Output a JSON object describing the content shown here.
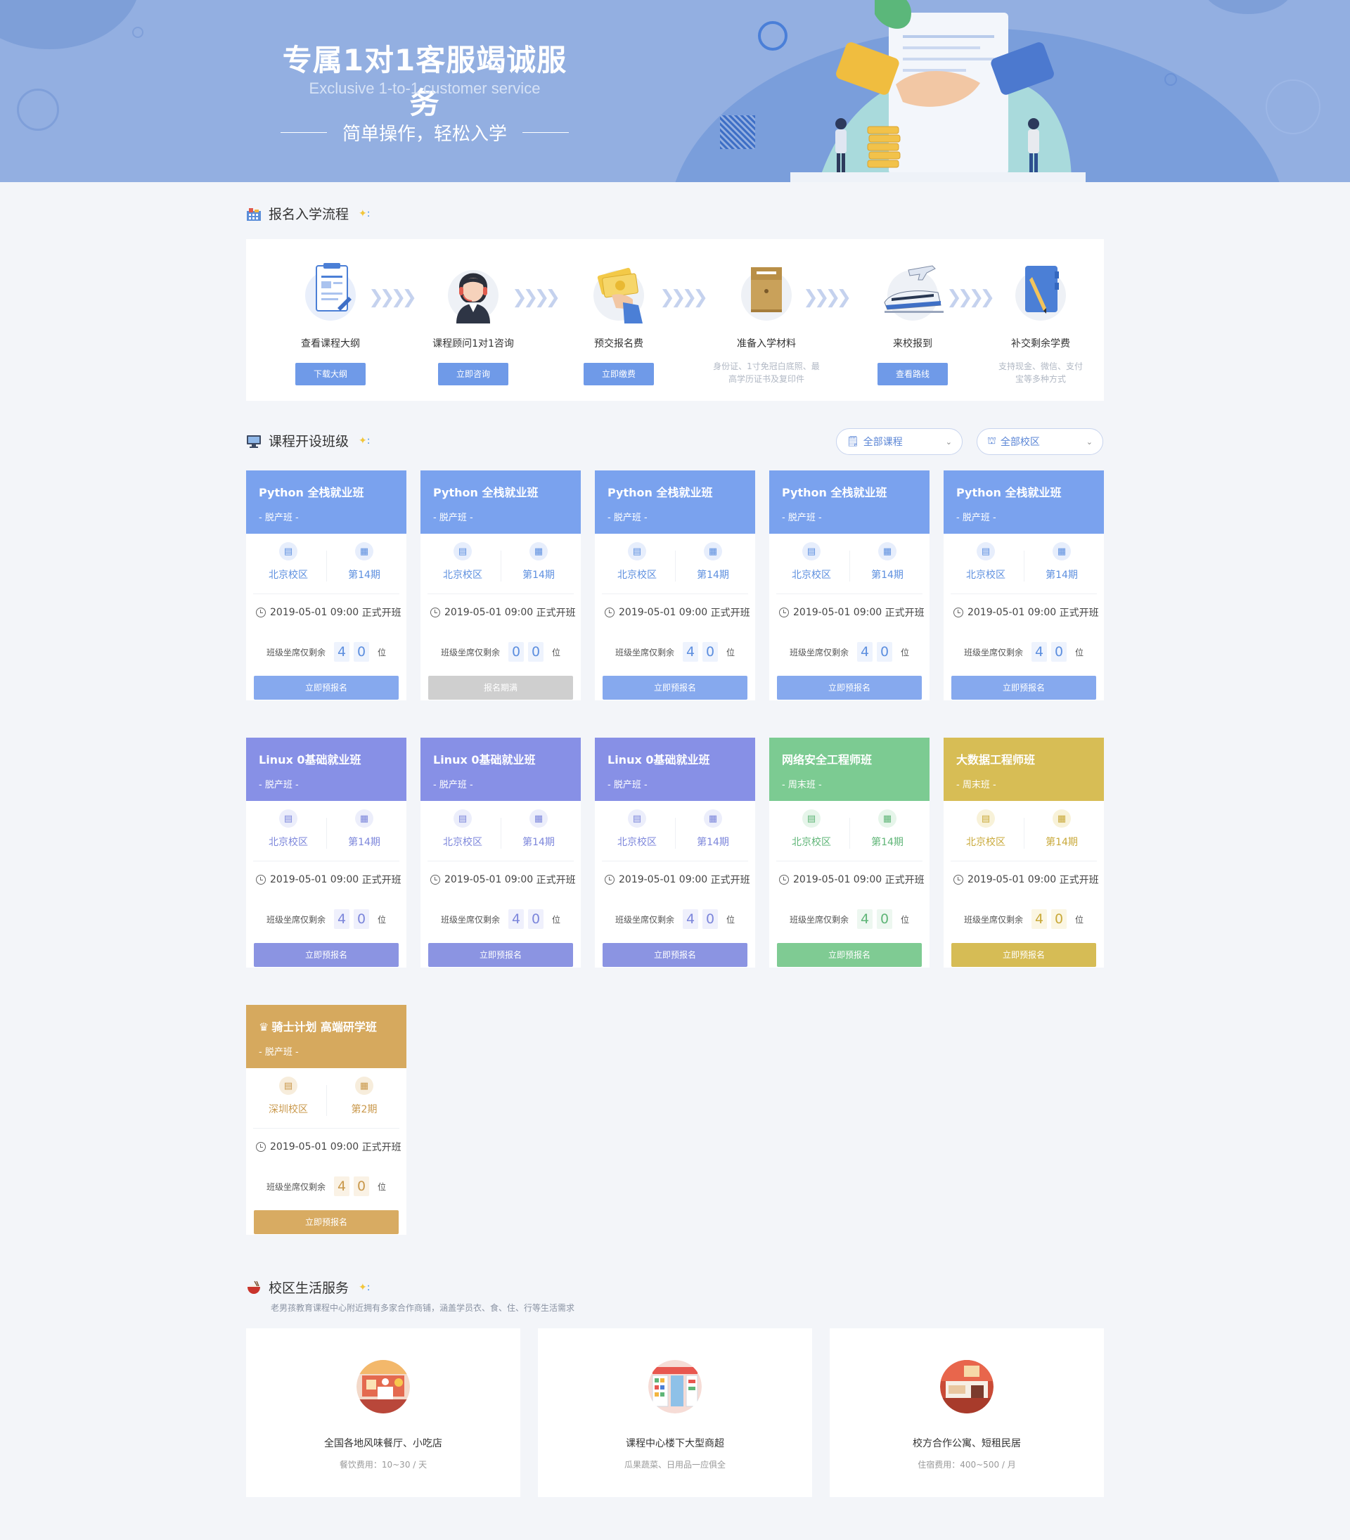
{
  "banner": {
    "title": "专属1对1客服竭诚服务",
    "subtitle": "Exclusive 1-to-1 customer service",
    "slogan": "简单操作，轻松入学"
  },
  "enroll": {
    "title": "报名入学流程",
    "steps": [
      {
        "name": "查看课程大纲",
        "button": "下载大纲",
        "icon": "syllabus-doc-icon"
      },
      {
        "name": "课程顾问1对1咨询",
        "button": "立即咨询",
        "icon": "consultant-headset-icon"
      },
      {
        "name": "预交报名费",
        "button": "立即缴费",
        "icon": "money-hand-icon"
      },
      {
        "name": "准备入学材料",
        "note": "身份证、1寸免冠白底照、最高学历证书及复印件",
        "icon": "folder-icon"
      },
      {
        "name": "来校报到",
        "button": "查看路线",
        "icon": "train-plane-icon"
      },
      {
        "name": "补交剩余学费",
        "note": "支持现金、微信、支付宝等多种方式",
        "icon": "notebook-pen-icon"
      }
    ]
  },
  "courses": {
    "title": "课程开设班级",
    "filters": [
      {
        "label": "全部课程",
        "icon": "course-list-icon"
      },
      {
        "label": "全部校区",
        "icon": "campus-icon"
      }
    ],
    "time_suffix": "正式开班",
    "seats_label": "班级坐席仅剩余",
    "seats_unit": "位",
    "cards": [
      {
        "title": "Python 全栈就业班",
        "sub": "- 脱产班 -",
        "campus": "北京校区",
        "period": "第14期",
        "date": "2019-05-01 09:00",
        "seats": [
          "4",
          "0"
        ],
        "button": "立即预报名",
        "theme": "blue"
      },
      {
        "title": "Python 全栈就业班",
        "sub": "- 脱产班 -",
        "campus": "北京校区",
        "period": "第14期",
        "date": "2019-05-01 09:00",
        "seats": [
          "0",
          "0"
        ],
        "button": "报名期满",
        "theme": "blue",
        "full": true
      },
      {
        "title": "Python 全栈就业班",
        "sub": "- 脱产班 -",
        "campus": "北京校区",
        "period": "第14期",
        "date": "2019-05-01 09:00",
        "seats": [
          "4",
          "0"
        ],
        "button": "立即预报名",
        "theme": "blue"
      },
      {
        "title": "Python 全栈就业班",
        "sub": "- 脱产班 -",
        "campus": "北京校区",
        "period": "第14期",
        "date": "2019-05-01 09:00",
        "seats": [
          "4",
          "0"
        ],
        "button": "立即预报名",
        "theme": "blue"
      },
      {
        "title": "Python 全栈就业班",
        "sub": "- 脱产班 -",
        "campus": "北京校区",
        "period": "第14期",
        "date": "2019-05-01 09:00",
        "seats": [
          "4",
          "0"
        ],
        "button": "立即预报名",
        "theme": "blue"
      },
      {
        "title": "Linux 0基础就业班",
        "sub": "- 脱产班 -",
        "campus": "北京校区",
        "period": "第14期",
        "date": "2019-05-01 09:00",
        "seats": [
          "4",
          "0"
        ],
        "button": "立即预报名",
        "theme": "purple"
      },
      {
        "title": "Linux 0基础就业班",
        "sub": "- 脱产班 -",
        "campus": "北京校区",
        "period": "第14期",
        "date": "2019-05-01 09:00",
        "seats": [
          "4",
          "0"
        ],
        "button": "立即预报名",
        "theme": "purple"
      },
      {
        "title": "Linux 0基础就业班",
        "sub": "- 脱产班 -",
        "campus": "北京校区",
        "period": "第14期",
        "date": "2019-05-01 09:00",
        "seats": [
          "4",
          "0"
        ],
        "button": "立即预报名",
        "theme": "purple"
      },
      {
        "title": "网络安全工程师班",
        "sub": "- 周末班 -",
        "campus": "北京校区",
        "period": "第14期",
        "date": "2019-05-01 09:00",
        "seats": [
          "4",
          "0"
        ],
        "button": "立即预报名",
        "theme": "green"
      },
      {
        "title": "大数据工程师班",
        "sub": "- 周末班 -",
        "campus": "北京校区",
        "period": "第14期",
        "date": "2019-05-01 09:00",
        "seats": [
          "4",
          "0"
        ],
        "button": "立即预报名",
        "theme": "gold"
      },
      {
        "title": "骑士计划 高端研学班",
        "sub": "- 脱产班 -",
        "campus": "深圳校区",
        "period": "第2期",
        "date": "2019-05-01 09:00",
        "seats": [
          "4",
          "0"
        ],
        "button": "立即预报名",
        "theme": "orange",
        "crown": true
      }
    ]
  },
  "life": {
    "title": "校区生活服务",
    "desc": "老男孩教育课程中心附近拥有多家合作商铺，涵盖学员衣、食、住、行等生活需求",
    "items": [
      {
        "title": "全国各地风味餐厅、小吃店",
        "desc": "餐饮费用：10~30 / 天",
        "icon": "restaurant-icon"
      },
      {
        "title": "课程中心楼下大型商超",
        "desc": "瓜果蔬菜、日用品一应俱全",
        "icon": "supermarket-icon"
      },
      {
        "title": "校方合作公寓、短租民居",
        "desc": "住宿费用：400~500 / 月",
        "icon": "apartment-icon"
      }
    ]
  },
  "themes": {
    "blue": {
      "head": "#7aa2ee",
      "text": "#5d8fdf",
      "btn": "#86a9ee",
      "iconbg": "#e7eefc",
      "digitbg": "#eef3fd"
    },
    "purple": {
      "head": "#8790e6",
      "text": "#7c86db",
      "btn": "#8b94e2",
      "iconbg": "#eceefb",
      "digitbg": "#eff0fc"
    },
    "green": {
      "head": "#7ccb92",
      "text": "#5fb577",
      "btn": "#7fcb93",
      "iconbg": "#e6f5ea",
      "digitbg": "#edf7f0"
    },
    "gold": {
      "head": "#d7bd55",
      "text": "#c9a93a",
      "btn": "#d6bc55",
      "iconbg": "#f8f2d9",
      "digitbg": "#fbf6e3"
    },
    "orange": {
      "head": "#d6a95e",
      "text": "#c9984b",
      "btn": "#d8ab62",
      "iconbg": "#f7eddc",
      "digitbg": "#faf2e5"
    },
    "full": {
      "btn": "#cfcfcf"
    }
  }
}
